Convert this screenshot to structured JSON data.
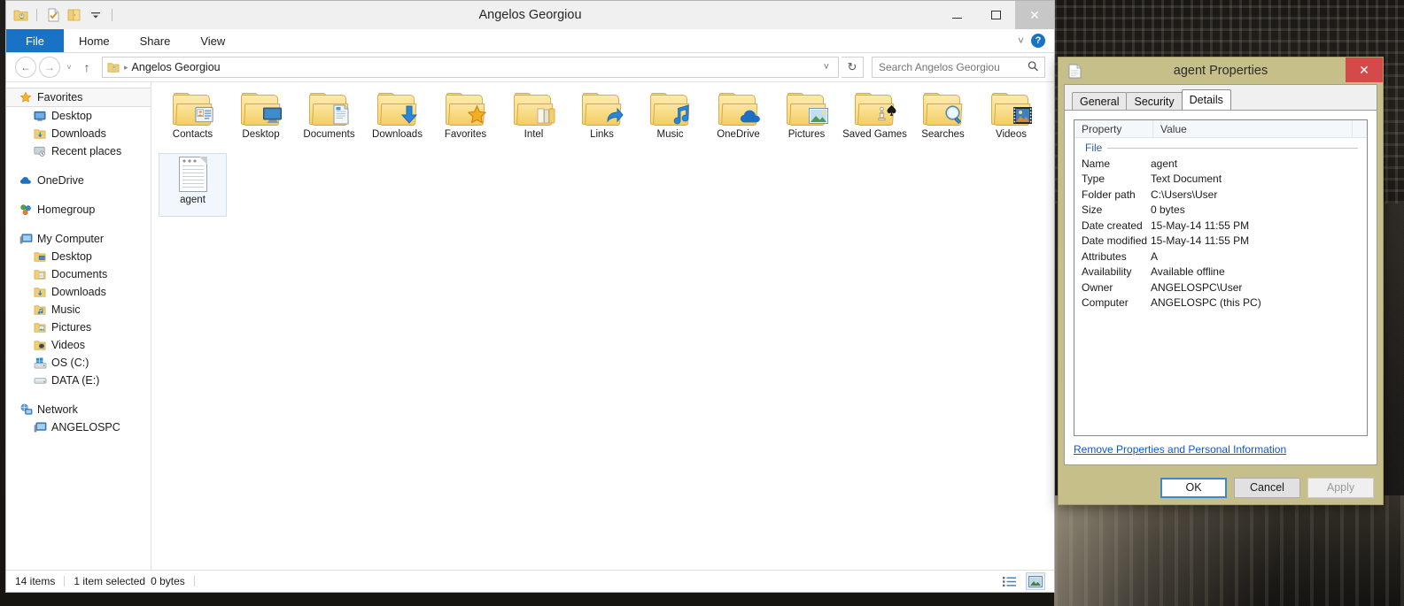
{
  "window": {
    "title": "Angelos Georgiou",
    "quick_access": [
      {
        "name": "folder-user-icon",
        "glyph": "📁"
      },
      {
        "name": "new-document-icon",
        "glyph": "📄"
      },
      {
        "name": "folder-open-icon",
        "glyph": "📂"
      },
      {
        "name": "customize-dropdown-icon",
        "glyph": "☰"
      }
    ],
    "buttons": {
      "minimize": "–",
      "maximize": "☐",
      "close": "✕"
    }
  },
  "ribbon": {
    "tabs": [
      {
        "label": "File",
        "active": true
      },
      {
        "label": "Home",
        "active": false
      },
      {
        "label": "Share",
        "active": false
      },
      {
        "label": "View",
        "active": false
      }
    ],
    "expand_icon": "˅",
    "help_icon": "?"
  },
  "address_bar": {
    "back_icon": "←",
    "forward_icon": "→",
    "history_icon": "˅",
    "up_icon": "↑",
    "path_icon": "📁",
    "path_separator": "▸",
    "path_text": "Angelos Georgiou",
    "dropdown_icon": "˅",
    "refresh_icon": "↻",
    "search_placeholder": "Search Angelos Georgiou",
    "search_value": "",
    "search_icon": "⚲"
  },
  "nav_pane": {
    "groups": [
      {
        "header": {
          "label": "Favorites",
          "icon": "★",
          "icon_color": "#f5b52a",
          "selected": true
        },
        "items": [
          {
            "label": "Desktop",
            "icon": "🖥",
            "icon_color": "#3a7cc0"
          },
          {
            "label": "Downloads",
            "icon": "⬇",
            "icon_color": "#2f80d2"
          },
          {
            "label": "Recent places",
            "icon": "🕒",
            "icon_color": "#7d8b99"
          }
        ]
      },
      {
        "header": {
          "label": "OneDrive",
          "icon": "☁",
          "icon_color": "#2a6fc9",
          "selected": false
        },
        "items": []
      },
      {
        "header": {
          "label": "Homegroup",
          "icon": "☸",
          "icon_color": "#4aa64a",
          "selected": false
        },
        "items": []
      },
      {
        "header": {
          "label": "My Computer",
          "icon": "💻",
          "icon_color": "#4a80b8",
          "selected": false
        },
        "items": [
          {
            "label": "Desktop",
            "icon": "📁",
            "icon_color": "#e8b94e"
          },
          {
            "label": "Documents",
            "icon": "📁",
            "icon_color": "#e8b94e"
          },
          {
            "label": "Downloads",
            "icon": "📁",
            "icon_color": "#e8b94e"
          },
          {
            "label": "Music",
            "icon": "📁",
            "icon_color": "#e8b94e"
          },
          {
            "label": "Pictures",
            "icon": "📁",
            "icon_color": "#e8b94e"
          },
          {
            "label": "Videos",
            "icon": "📁",
            "icon_color": "#e8b94e"
          },
          {
            "label": "OS (C:)",
            "icon": "🖴",
            "icon_color": "#5a8fc4"
          },
          {
            "label": "DATA (E:)",
            "icon": "🖴",
            "icon_color": "#8f9aa5"
          }
        ]
      },
      {
        "header": {
          "label": "Network",
          "icon": "🌐",
          "icon_color": "#4a90c8",
          "selected": false
        },
        "items": [
          {
            "label": "ANGELOSPC",
            "icon": "💻",
            "icon_color": "#4a80b8"
          }
        ]
      }
    ]
  },
  "content": {
    "items": [
      {
        "label": "Contacts",
        "type": "folder",
        "emblem": "📇",
        "selected": false
      },
      {
        "label": "Desktop",
        "type": "folder",
        "emblem": "🖥",
        "selected": false
      },
      {
        "label": "Documents",
        "type": "folder",
        "emblem": "📄",
        "selected": false
      },
      {
        "label": "Downloads",
        "type": "folder",
        "emblem": "⬇",
        "selected": false
      },
      {
        "label": "Favorites",
        "type": "folder",
        "emblem": "⭐",
        "selected": false
      },
      {
        "label": "Intel",
        "type": "folder",
        "emblem": "",
        "selected": false
      },
      {
        "label": "Links",
        "type": "folder",
        "emblem": "↗",
        "selected": false
      },
      {
        "label": "Music",
        "type": "folder",
        "emblem": "♪",
        "selected": false
      },
      {
        "label": "OneDrive",
        "type": "folder",
        "emblem": "☁",
        "selected": false
      },
      {
        "label": "Pictures",
        "type": "folder",
        "emblem": "🏞",
        "selected": false
      },
      {
        "label": "Saved Games",
        "type": "folder",
        "emblem": "♟",
        "selected": false
      },
      {
        "label": "Searches",
        "type": "folder",
        "emblem": "🔍",
        "selected": false
      },
      {
        "label": "Videos",
        "type": "folder",
        "emblem": "🎬",
        "selected": false
      },
      {
        "label": "agent",
        "type": "textfile",
        "emblem": "",
        "selected": true
      }
    ]
  },
  "status_bar": {
    "item_count": "14 items",
    "selection": "1 item selected",
    "size": "0 bytes",
    "view_details_icon": "≣",
    "view_icons_icon": "▦"
  },
  "properties_dialog": {
    "title": "agent Properties",
    "title_icon": "📄",
    "close_label": "✕",
    "tabs": [
      {
        "label": "General",
        "active": false
      },
      {
        "label": "Security",
        "active": false
      },
      {
        "label": "Details",
        "active": true
      }
    ],
    "list_headers": {
      "property": "Property",
      "value": "Value"
    },
    "group_label": "File",
    "rows": [
      {
        "key": "Name",
        "value": "agent"
      },
      {
        "key": "Type",
        "value": "Text Document"
      },
      {
        "key": "Folder path",
        "value": "C:\\Users\\User"
      },
      {
        "key": "Size",
        "value": "0 bytes"
      },
      {
        "key": "Date created",
        "value": "15-May-14 11:55 PM"
      },
      {
        "key": "Date modified",
        "value": "15-May-14 11:55 PM"
      },
      {
        "key": "Attributes",
        "value": "A"
      },
      {
        "key": "Availability",
        "value": "Available offline"
      },
      {
        "key": "Owner",
        "value": "ANGELOSPC\\User"
      },
      {
        "key": "Computer",
        "value": "ANGELOSPC (this PC)"
      }
    ],
    "remove_link": "Remove Properties and Personal Information",
    "buttons": {
      "ok": "OK",
      "cancel": "Cancel",
      "apply": "Apply"
    }
  },
  "colors": {
    "file_tab_blue": "#1a72c4",
    "dialog_frame": "#c6bf8a",
    "close_red": "#d44a4a",
    "link_blue": "#1155cc",
    "group_blue": "#2c5f9e"
  }
}
